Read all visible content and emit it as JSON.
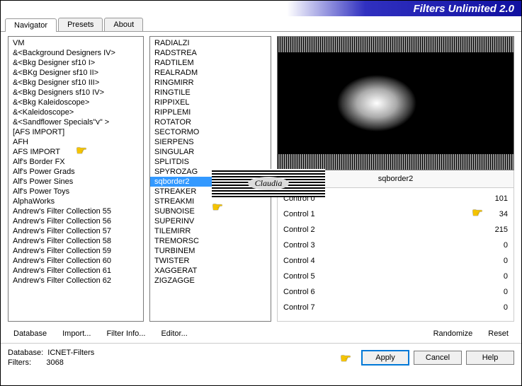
{
  "title": "Filters Unlimited 2.0",
  "tabs": [
    "Navigator",
    "Presets",
    "About"
  ],
  "active_tab": 0,
  "left_list": [
    "VM",
    "&<Background Designers IV>",
    "&<Bkg Designer sf10 I>",
    "&<BKg Designer sf10 II>",
    "&<Bkg Designer sf10 III>",
    "&<Bkg Designers sf10 IV>",
    "&<Bkg Kaleidoscope>",
    "&<Kaleidoscope>",
    "&<Sandflower Specials\"v\" >",
    "[AFS IMPORT]",
    "AFH",
    "AFS IMPORT",
    "Alf's Border FX",
    "Alf's Power Grads",
    "Alf's Power Sines",
    "Alf's Power Toys",
    "AlphaWorks",
    "Andrew's Filter Collection 55",
    "Andrew's Filter Collection 56",
    "Andrew's Filter Collection 57",
    "Andrew's Filter Collection 58",
    "Andrew's Filter Collection 59",
    "Andrew's Filter Collection 60",
    "Andrew's Filter Collection 61",
    "Andrew's Filter Collection 62"
  ],
  "mid_list": [
    "RADIALZI",
    "RADSTREA",
    "RADTILEM",
    "REALRADM",
    "RINGMIRR",
    "RINGTILE",
    "RIPPIXEL",
    "RIPPLEMI",
    "ROTATOR",
    "SECTORMO",
    "SIERPENS",
    "SINGULAR",
    "SPLITDIS",
    "SPYROZAG",
    "sqborder2",
    "STREAKER",
    "STREAKMI",
    "SUBNOISE",
    "SUPERINV",
    "TILEMIRR",
    "TREMORSC",
    "TURBINEM",
    "TWISTER",
    "XAGGERAT",
    "ZIGZAGGE"
  ],
  "mid_selected_index": 14,
  "filter_name": "sqborder2",
  "controls": [
    {
      "label": "Control 0",
      "value": 101
    },
    {
      "label": "Control 1",
      "value": 34
    },
    {
      "label": "Control 2",
      "value": 215
    },
    {
      "label": "Control 3",
      "value": 0
    },
    {
      "label": "Control 4",
      "value": 0
    },
    {
      "label": "Control 5",
      "value": 0
    },
    {
      "label": "Control 6",
      "value": 0
    },
    {
      "label": "Control 7",
      "value": 0
    }
  ],
  "buttons": {
    "database": "Database",
    "import": "Import...",
    "filter_info": "Filter Info...",
    "editor": "Editor...",
    "randomize": "Randomize",
    "reset": "Reset",
    "apply": "Apply",
    "cancel": "Cancel",
    "help": "Help"
  },
  "footer": {
    "db_label": "Database:",
    "db_value": "ICNET-Filters",
    "filters_label": "Filters:",
    "filters_value": "3068"
  },
  "logo_text": "Claudia"
}
